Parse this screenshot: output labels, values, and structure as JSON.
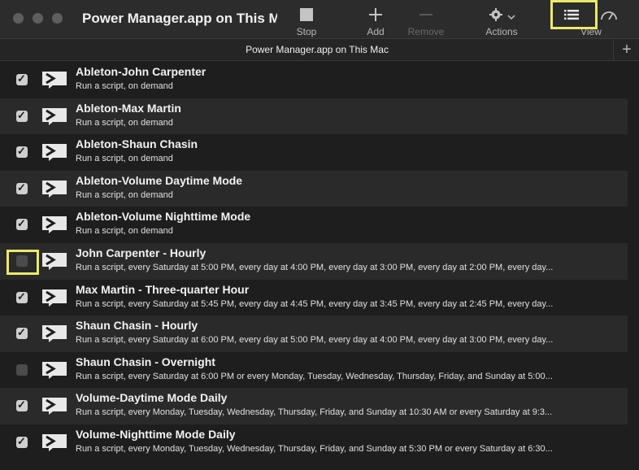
{
  "window": {
    "title": "Power Manager.app on This Mac"
  },
  "toolbar": {
    "stop": "Stop",
    "add": "Add",
    "remove": "Remove",
    "actions": "Actions",
    "view": "View"
  },
  "subheader": {
    "title": "Power Manager.app on This Mac",
    "plus": "+"
  },
  "colors": {
    "highlight": "#ece96a",
    "background": "#1e1e1e",
    "row_alt": "#2a2a2a"
  },
  "rows": [
    {
      "title": "Ableton-John Carpenter",
      "subtitle": "Run a script, on demand",
      "checked": true
    },
    {
      "title": "Ableton-Max Martin",
      "subtitle": "Run a script, on demand",
      "checked": true
    },
    {
      "title": "Ableton-Shaun Chasin",
      "subtitle": "Run a script, on demand",
      "checked": true
    },
    {
      "title": "Ableton-Volume Daytime Mode",
      "subtitle": "Run a script, on demand",
      "checked": true
    },
    {
      "title": "Ableton-Volume Nighttime Mode",
      "subtitle": "Run a script, on demand",
      "checked": true
    },
    {
      "title": "John Carpenter - Hourly",
      "subtitle": "Run a script, every Saturday at 5:00 PM, every day at 4:00 PM, every day at 3:00 PM, every day at 2:00 PM, every day...",
      "checked": false
    },
    {
      "title": "Max Martin - Three-quarter Hour",
      "subtitle": "Run a script, every Saturday at 5:45 PM, every day at 4:45 PM, every day at 3:45 PM, every day at 2:45 PM, every day...",
      "checked": true
    },
    {
      "title": "Shaun Chasin - Hourly",
      "subtitle": "Run a script, every Saturday at 6:00 PM, every day at 5:00 PM, every day at 4:00 PM, every day at 3:00 PM, every day...",
      "checked": true
    },
    {
      "title": "Shaun Chasin - Overnight",
      "subtitle": "Run a script, every Saturday at 6:00 PM or every Monday, Tuesday, Wednesday, Thursday, Friday, and Sunday at 5:00...",
      "checked": false
    },
    {
      "title": "Volume-Daytime Mode Daily",
      "subtitle": "Run a script, every Monday, Tuesday, Wednesday, Thursday, Friday, and Sunday at 10:30 AM or every Saturday at 9:3...",
      "checked": true
    },
    {
      "title": "Volume-Nighttime Mode Daily",
      "subtitle": "Run a script, every Monday, Tuesday, Wednesday, Thursday, Friday, and Sunday at 5:30 PM or every Saturday at 6:30...",
      "checked": true
    }
  ]
}
